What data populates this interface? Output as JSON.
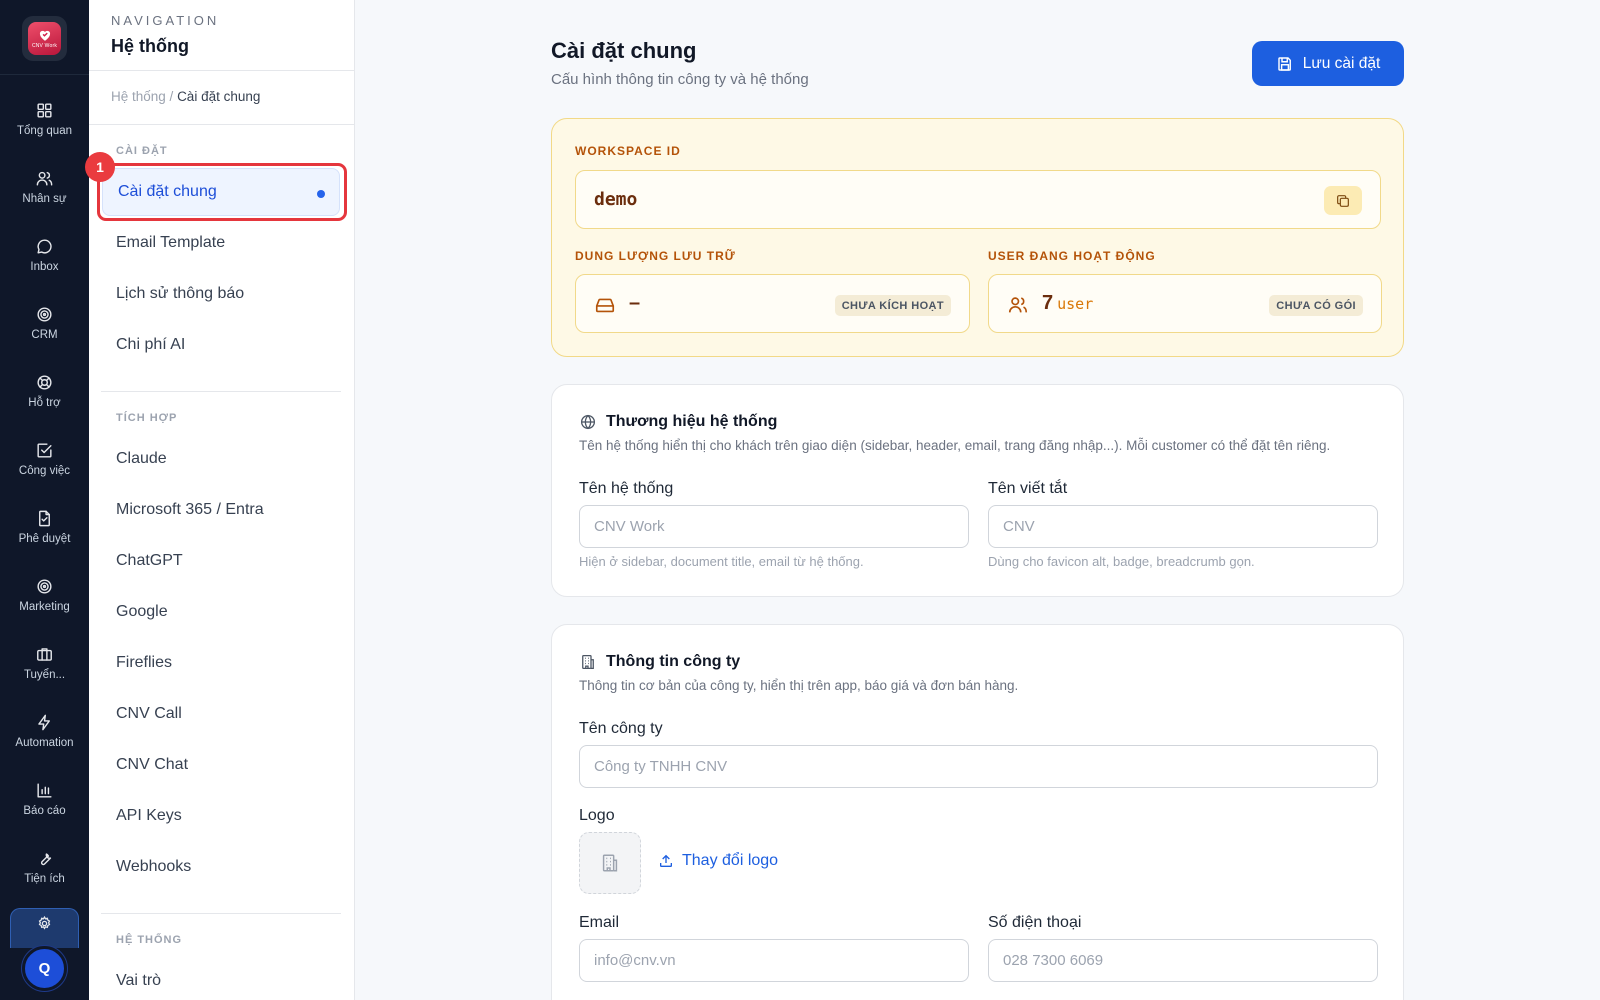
{
  "rail": {
    "logo_text": "CNV Work",
    "items": [
      {
        "label": "Tổng quan",
        "icon": "grid-icon"
      },
      {
        "label": "Nhân sự",
        "icon": "users-icon"
      },
      {
        "label": "Inbox",
        "icon": "chat-icon"
      },
      {
        "label": "CRM",
        "icon": "target-icon"
      },
      {
        "label": "Hỗ trợ",
        "icon": "lifebuoy-icon"
      },
      {
        "label": "Công việc",
        "icon": "checkbox-icon"
      },
      {
        "label": "Phê duyệt",
        "icon": "approval-icon"
      },
      {
        "label": "Marketing",
        "icon": "target-icon"
      },
      {
        "label": "Tuyển...",
        "icon": "briefcase-icon"
      },
      {
        "label": "Automation",
        "icon": "bolt-icon"
      },
      {
        "label": "Báo cáo",
        "icon": "bar-chart-icon"
      },
      {
        "label": "Tiện ích",
        "icon": "wrench-icon"
      }
    ],
    "active_icon": "gear-icon",
    "avatar_initial": "Q"
  },
  "sidebar": {
    "nav_label": "NAVIGATION",
    "title": "Hệ thống",
    "breadcrumb_parent": "Hệ thống",
    "breadcrumb_sep": " / ",
    "breadcrumb_current": "Cài đặt chung",
    "sections": {
      "settings": "CÀI ĐẶT",
      "integrations": "TÍCH HỢP",
      "system": "HỆ THỐNG"
    },
    "settings_items": [
      "Cài đặt chung",
      "Email Template",
      "Lịch sử thông báo",
      "Chi phí AI"
    ],
    "integration_items": [
      "Claude",
      "Microsoft 365 / Entra",
      "ChatGPT",
      "Google",
      "Fireflies",
      "CNV Call",
      "CNV Chat",
      "API Keys",
      "Webhooks"
    ],
    "system_items": [
      "Vai trò"
    ],
    "annotation_number": "1"
  },
  "main": {
    "title": "Cài đặt chung",
    "subtitle": "Cấu hình thông tin công ty và hệ thống",
    "save_label": "Lưu cài đặt",
    "workspace": {
      "id_label": "WORKSPACE ID",
      "id_value": "demo",
      "storage_label": "DUNG LƯỢNG LƯU TRỮ",
      "storage_value": "–",
      "storage_status": "CHƯA KÍCH HOẠT",
      "users_label": "USER ĐANG HOẠT ĐỘNG",
      "users_count": "7",
      "users_unit": "user",
      "users_status": "CHƯA CÓ GÓI"
    },
    "branding": {
      "title": "Thương hiệu hệ thống",
      "desc": "Tên hệ thống hiển thị cho khách trên giao diện (sidebar, header, email, trang đăng nhập...). Mỗi customer có thể đặt tên riêng.",
      "name_label": "Tên hệ thống",
      "name_placeholder": "CNV Work",
      "name_hint": "Hiện ở sidebar, document title, email từ hệ thống.",
      "short_label": "Tên viết tắt",
      "short_placeholder": "CNV",
      "short_hint": "Dùng cho favicon alt, badge, breadcrumb gọn."
    },
    "company": {
      "title": "Thông tin công ty",
      "desc": "Thông tin cơ bản của công ty, hiển thị trên app, báo giá và đơn bán hàng.",
      "name_label": "Tên công ty",
      "name_placeholder": "Công ty TNHH CNV",
      "logo_label": "Logo",
      "change_logo": "Thay đổi logo",
      "email_label": "Email",
      "email_placeholder": "info@cnv.vn",
      "phone_label": "Số điện thoại",
      "phone_placeholder": "028 7300 6069"
    }
  }
}
